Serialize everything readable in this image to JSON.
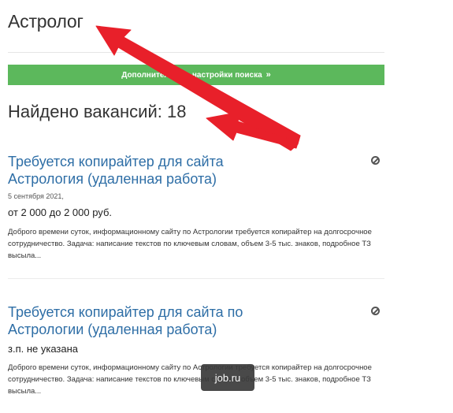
{
  "page": {
    "title": "Астролог"
  },
  "filter": {
    "label": "Дополнительные настройки поиска",
    "chevron": "»"
  },
  "found": {
    "label": "Найдено вакансий:",
    "count": "18"
  },
  "vacancies": [
    {
      "title": "Требуется копирайтер для сайта Астрология (удаленная работа)",
      "date": "5 сентября 2021,",
      "salary": "от 2 000 до 2 000 руб.",
      "description": "Доброго времени суток, информационному сайту по Астрологии требуется копирайтер на долгосрочное сотрудничество. Задача: написание текстов по ключевым словам, объем 3-5 тыс. знаков, подробное ТЗ высыла..."
    },
    {
      "title": "Требуется копирайтер для сайта по Астрологии (удаленная работа)",
      "salary": "з.п. не указана",
      "description": "Доброго времени суток, информационному сайту по Астрологии требуется копирайтер на долгосрочное сотрудничество. Задача: написание текстов по ключевым словам, объем 3-5 тыс. знаков, подробное ТЗ высыла..."
    }
  ],
  "watermark": {
    "text": "job.ru"
  },
  "colors": {
    "accent_green": "#5cb85c",
    "link_blue": "#2e6ea6",
    "arrow_red": "#e8202a"
  },
  "icons": {
    "hide": "block-icon",
    "filter_chevron": "double-chevron-down-icon"
  }
}
